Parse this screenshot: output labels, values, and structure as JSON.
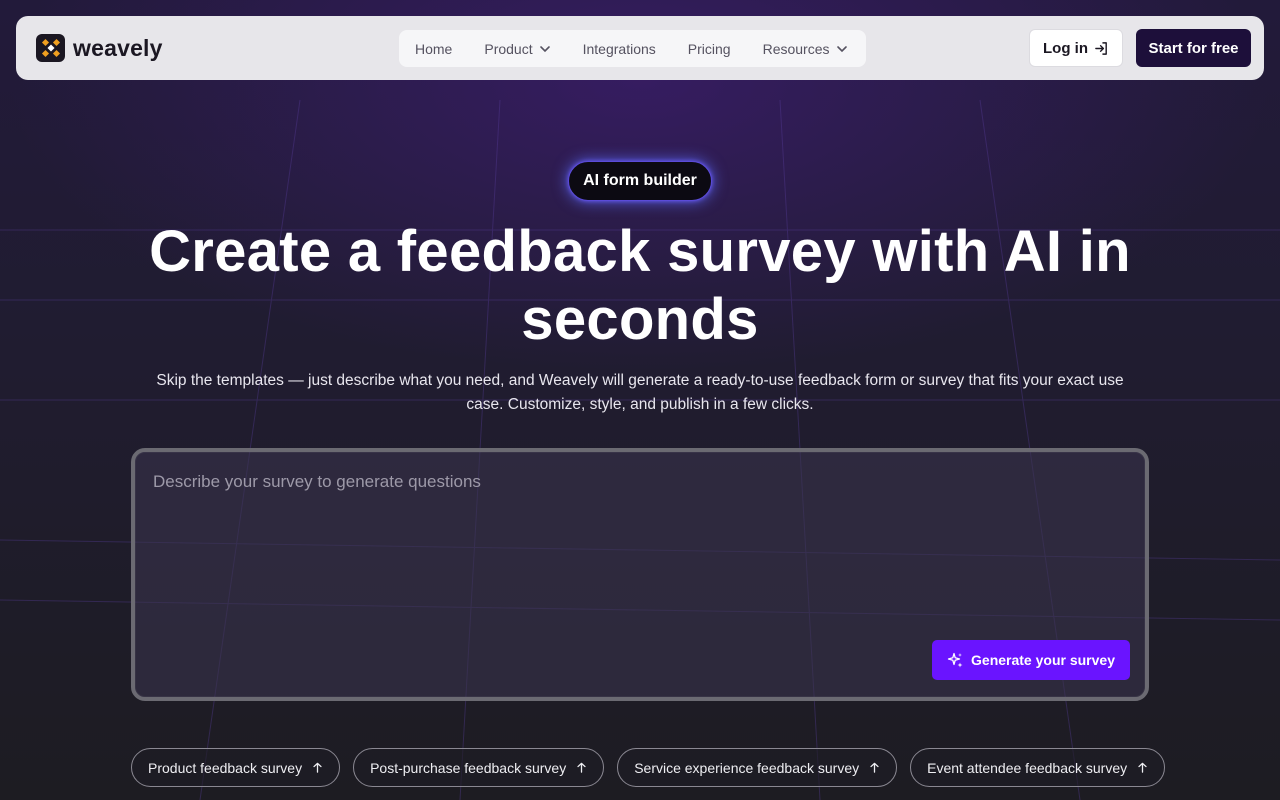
{
  "brand": {
    "name": "weavely",
    "logo_icon": "weavely-logo-icon"
  },
  "nav": {
    "items": [
      {
        "label": "Home",
        "has_dropdown": false
      },
      {
        "label": "Product",
        "has_dropdown": true
      },
      {
        "label": "Integrations",
        "has_dropdown": false
      },
      {
        "label": "Pricing",
        "has_dropdown": false
      },
      {
        "label": "Resources",
        "has_dropdown": true
      }
    ],
    "login_label": "Log in",
    "login_icon": "sign-in-icon",
    "start_label": "Start for free"
  },
  "hero": {
    "badge": "AI form builder",
    "title": "Create a feedback survey with AI in seconds",
    "subtitle": "Skip the templates — just describe what you need, and Weavely will generate a ready-to-use feedback form or survey that fits your exact use case. Customize, style, and publish in a few clicks."
  },
  "prompt": {
    "placeholder": "Describe your survey to generate questions",
    "value": "",
    "generate_label": "Generate your survey",
    "generate_icon": "sparkle-icon"
  },
  "suggestions": [
    {
      "label": "Product feedback survey",
      "icon": "arrow-up-icon"
    },
    {
      "label": "Post-purchase feedback survey",
      "icon": "arrow-up-icon"
    },
    {
      "label": "Service experience feedback survey",
      "icon": "arrow-up-icon"
    },
    {
      "label": "Event attendee feedback survey",
      "icon": "arrow-up-icon"
    }
  ],
  "colors": {
    "accent": "#6a14ff",
    "dark_button": "#1d0f3a",
    "logo_orange": "#f0a020"
  }
}
